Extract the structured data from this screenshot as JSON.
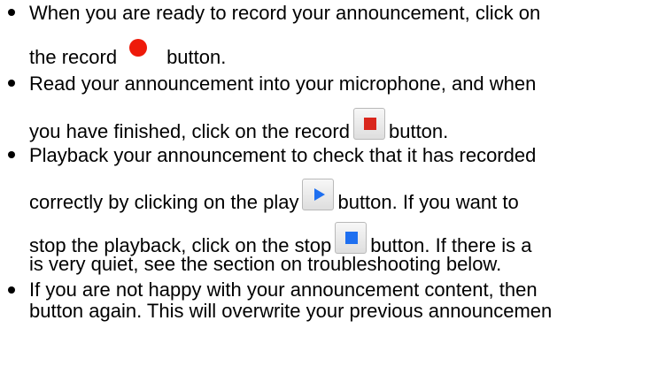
{
  "steps": [
    {
      "line1": "When you are ready to record your announcement, click on",
      "line2_a": "the record",
      "line2_b": "button."
    },
    {
      "line1": "Read your announcement into your microphone, and when",
      "line2_a": "you have finished, click on the record",
      "line2_b": "button."
    },
    {
      "line1": "Playback your announcement to check that it has recorded",
      "line2_a": "correctly by clicking on the play",
      "line2_b": "button. If you want to",
      "line3_a": "stop the playback, click on the stop",
      "line3_b": "button. If there is a",
      "line4": "is very quiet, see the section on troubleshooting below."
    },
    {
      "line1": "If you are not happy with your announcement content, then",
      "line2": "button again. This will overwrite your previous announcemen"
    }
  ],
  "icons": {
    "record": "record-dot-icon",
    "stop_record": "stop-record-icon",
    "play": "play-icon",
    "stop": "stop-icon"
  },
  "colors": {
    "record_red": "#ee1a0a",
    "stop_record_red": "#d9261c",
    "play_blue": "#1e6ff0"
  }
}
